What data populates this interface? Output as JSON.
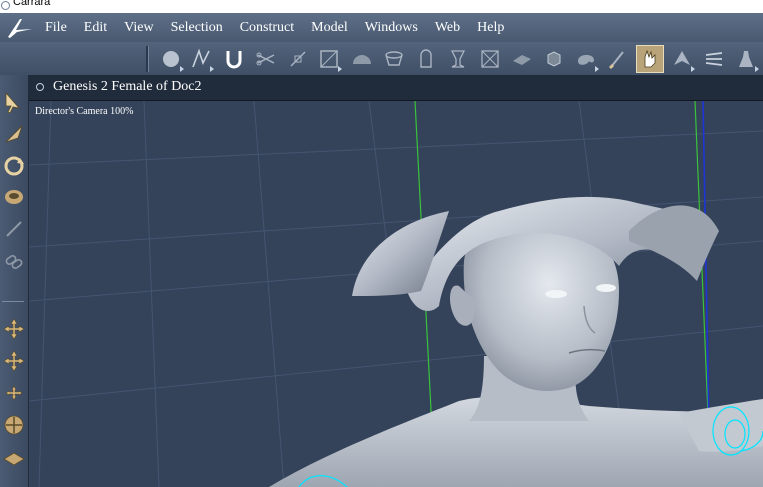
{
  "window": {
    "title": "Carrara"
  },
  "menubar": {
    "items": [
      "File",
      "Edit",
      "View",
      "Selection",
      "Construct",
      "Model",
      "Windows",
      "Web",
      "Help"
    ]
  },
  "toolbar": {
    "tools": [
      {
        "icon": "sphere-primitive-icon",
        "has_flyout": true
      },
      {
        "icon": "spline-tool-icon",
        "has_flyout": true
      },
      {
        "icon": "magnet-icon",
        "has_flyout": false
      },
      {
        "icon": "scissors-icon",
        "has_flyout": false
      },
      {
        "icon": "vertex-edit-icon",
        "has_flyout": false
      },
      {
        "icon": "bounding-box-icon",
        "has_flyout": true
      },
      {
        "icon": "dome-icon",
        "has_flyout": false
      },
      {
        "icon": "lathe-icon",
        "has_flyout": false
      },
      {
        "icon": "cylinder-icon",
        "has_flyout": false
      },
      {
        "icon": "goblet-icon",
        "has_flyout": false
      },
      {
        "icon": "frame-icon",
        "has_flyout": false
      },
      {
        "icon": "plane-icon",
        "has_flyout": false
      },
      {
        "icon": "cube-icon",
        "has_flyout": false
      },
      {
        "icon": "palette-icon",
        "has_flyout": true
      },
      {
        "icon": "brush-icon",
        "has_flyout": false
      },
      {
        "icon": "pose-hand-icon",
        "has_flyout": false,
        "active": true
      },
      {
        "icon": "morph-icon",
        "has_flyout": true
      },
      {
        "icon": "deform-icon",
        "has_flyout": false
      },
      {
        "icon": "character-icon",
        "has_flyout": true
      }
    ]
  },
  "lefttools": {
    "tools": [
      "selection-arrow-icon",
      "rotate-arrow-icon",
      "spin-icon",
      "disc-icon",
      "pen-tool-icon",
      "chain-link-icon",
      "move-cross-icon",
      "move-cross-icon",
      "move-cross-small-icon",
      "trackball-icon",
      "ground-plane-icon"
    ]
  },
  "document": {
    "title": "Genesis 2 Female of Doc2"
  },
  "viewport": {
    "camera_label": "Director's Camera 100%"
  },
  "colors": {
    "menubar": "#52637b",
    "viewport_bg": "#34435a",
    "grid_line": "#445571",
    "y_axis": "#39c23b",
    "z_axis": "#1e35d6",
    "gizmo": "#00e5ff",
    "model": "#c7cdd5"
  }
}
